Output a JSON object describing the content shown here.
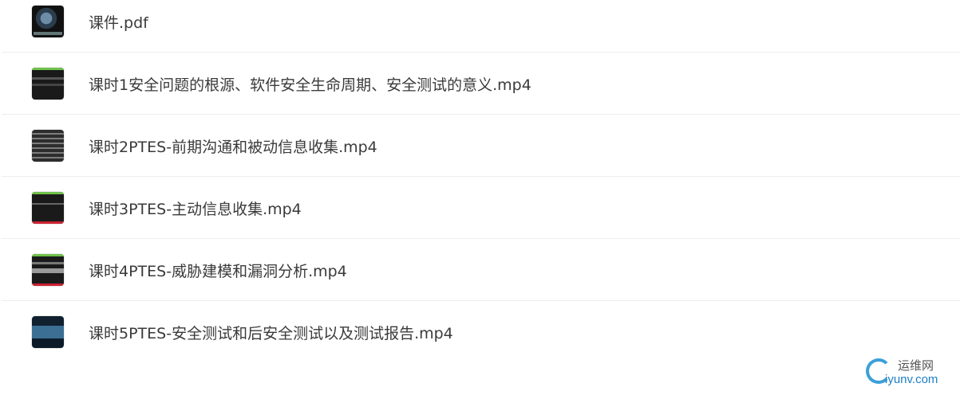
{
  "files": [
    {
      "name": "课件.pdf",
      "icon": "pdf-thumbnail-icon"
    },
    {
      "name": "课时1安全问题的根源、软件安全生命周期、安全测试的意义.mp4",
      "icon": "video-thumbnail-icon"
    },
    {
      "name": "课时2PTES-前期沟通和被动信息收集.mp4",
      "icon": "video-thumbnail-icon"
    },
    {
      "name": "课时3PTES-主动信息收集.mp4",
      "icon": "video-thumbnail-icon"
    },
    {
      "name": "课时4PTES-威胁建模和漏洞分析.mp4",
      "icon": "video-thumbnail-icon"
    },
    {
      "name": "课时5PTES-安全测试和后安全测试以及测试报告.mp4",
      "icon": "video-thumbnail-icon"
    }
  ],
  "watermark": {
    "top_text": "运维网",
    "bottom_text": "iyunv.com",
    "color": "#3aa0d8"
  }
}
